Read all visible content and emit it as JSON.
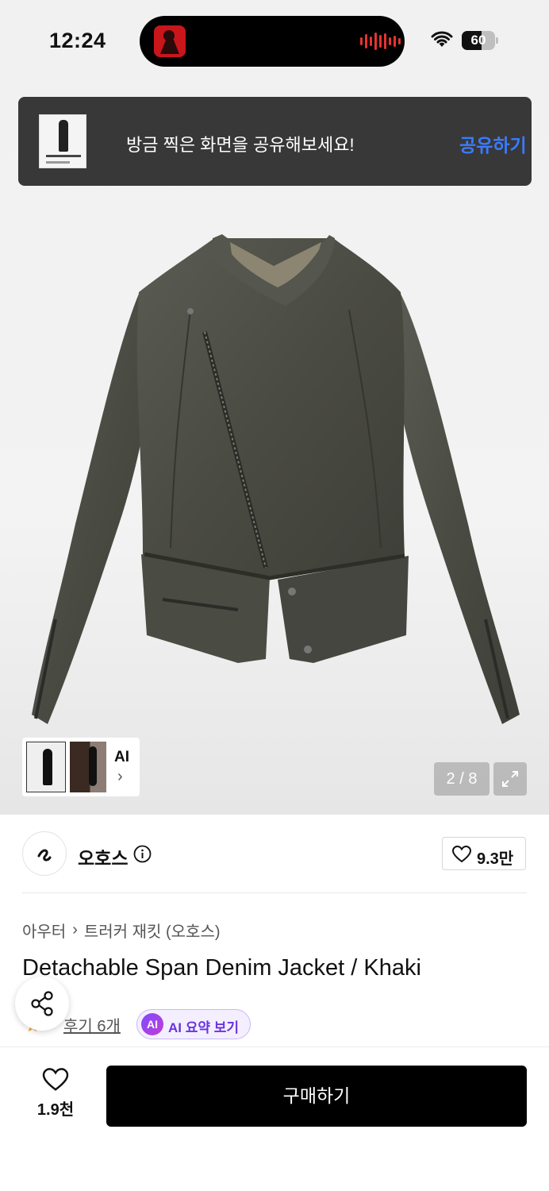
{
  "status_bar": {
    "time": "12:24",
    "battery": "60",
    "battery_level": 0.6,
    "icons": [
      "wifi-icon",
      "battery-icon"
    ]
  },
  "toast": {
    "message": "방금 찍은 화면을 공유해보세요!",
    "action": "공유하기",
    "action_color": "#3a7bff"
  },
  "gallery": {
    "ai_label": "AI",
    "current": 2,
    "total": 8,
    "counter": "2 / 8"
  },
  "brand": {
    "name": "오호스",
    "likes": "9.3만"
  },
  "product": {
    "breadcrumb": [
      "아우터",
      "트러커 재킷 (오호스)"
    ],
    "title": "Detachable Span Denim Jacket / Khaki",
    "review_label": "후기 6개",
    "ai_summary": "AI 요약 보기",
    "ai_badge": "AI"
  },
  "bottom_bar": {
    "wish_count": "1.9천",
    "buy_label": "구매하기"
  },
  "colors": {
    "accent_blue": "#3a7bff",
    "ai_purple": "#6a32e0",
    "buy_button": "#000000"
  }
}
